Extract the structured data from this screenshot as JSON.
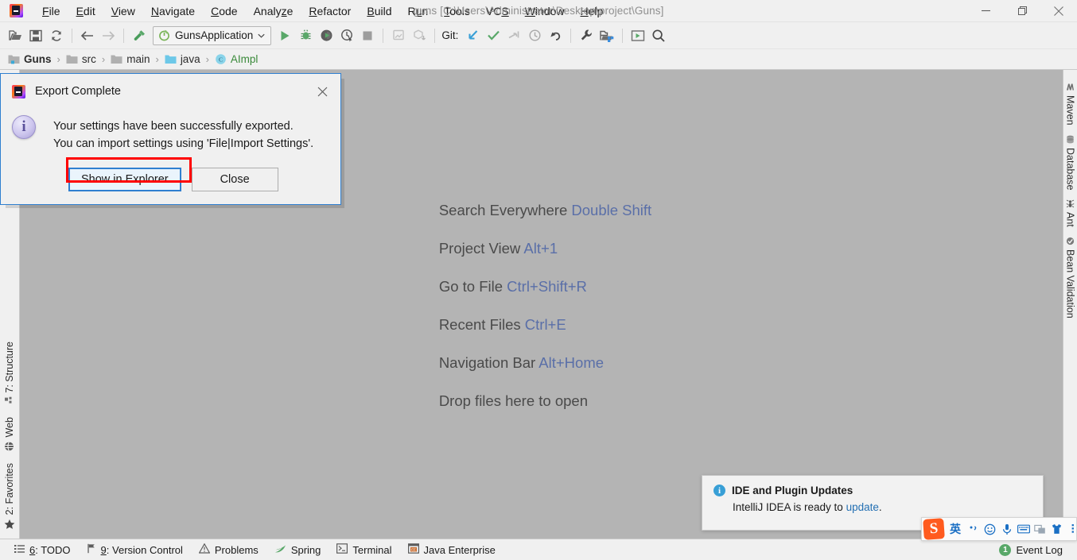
{
  "window": {
    "title": "guns [C:\\Users\\Administrator\\Desktop\\project\\Guns]",
    "minimize_label": "minimize-icon",
    "maximize_label": "restore-icon",
    "close_label": "close-icon"
  },
  "menubar": {
    "items": [
      {
        "label": "File",
        "mnemonic": "F"
      },
      {
        "label": "Edit",
        "mnemonic": "E"
      },
      {
        "label": "View",
        "mnemonic": "V"
      },
      {
        "label": "Navigate",
        "mnemonic": "N"
      },
      {
        "label": "Code",
        "mnemonic": "C"
      },
      {
        "label": "Analyze",
        "mnemonic": "z"
      },
      {
        "label": "Refactor",
        "mnemonic": "R"
      },
      {
        "label": "Build",
        "mnemonic": "B"
      },
      {
        "label": "Run",
        "mnemonic": "u"
      },
      {
        "label": "Tools",
        "mnemonic": "T"
      },
      {
        "label": "VCS",
        "mnemonic": "S"
      },
      {
        "label": "Window",
        "mnemonic": "W"
      },
      {
        "label": "Help",
        "mnemonic": "H"
      }
    ]
  },
  "toolbar": {
    "open_icon": "open-folder-icon",
    "save_icon": "save-icon",
    "sync_icon": "sync-icon",
    "back_icon": "back-arrow-icon",
    "forward_icon": "forward-arrow-icon",
    "build_icon": "build-hammer-icon",
    "run_config": "GunsApplication",
    "run_icon": "run-icon",
    "debug_icon": "debug-icon",
    "run_coverage_icon": "run-with-coverage-icon",
    "profile_icon": "profiler-icon",
    "stop_icon": "stop-icon",
    "update_app_icon": "update-application-icon",
    "deploy_icon": "deploy-icon",
    "git_label": "Git:",
    "git_update_icon": "git-update-project-icon",
    "git_commit_icon": "git-commit-icon",
    "git_push_icon": "git-push-icon",
    "git_history_icon": "git-history-icon",
    "git_rollback_icon": "git-rollback-icon",
    "settings_icon": "wrench-settings-icon",
    "project_structure_icon": "project-structure-icon",
    "run_console_icon": "run-console-icon",
    "search_icon": "search-icon"
  },
  "breadcrumb": {
    "items": [
      {
        "label": "Guns",
        "icon": "project-folder-icon",
        "bold": true,
        "color": "#2b2b2b"
      },
      {
        "label": "src",
        "icon": "folder-icon",
        "bold": false,
        "color": "#2b2b2b"
      },
      {
        "label": "main",
        "icon": "folder-icon",
        "bold": false,
        "color": "#2b2b2b"
      },
      {
        "label": "java",
        "icon": "source-folder-icon",
        "bold": false,
        "color": "#2b2b2b"
      },
      {
        "label": "AImpl",
        "icon": "java-class-icon",
        "bold": false,
        "color": "#3a8a3a"
      }
    ],
    "separator": "›"
  },
  "sidebar_left": {
    "items": [
      {
        "label": "7: Structure",
        "mnemonic": "7",
        "icon": "structure-icon"
      },
      {
        "label": "Web",
        "mnemonic": "",
        "icon": "web-globe-icon"
      },
      {
        "label": "2: Favorites",
        "mnemonic": "2",
        "icon": "favorites-star-icon"
      }
    ]
  },
  "sidebar_right": {
    "items": [
      {
        "label": "Maven",
        "icon": "maven-icon"
      },
      {
        "label": "Database",
        "icon": "database-icon"
      },
      {
        "label": "Ant",
        "icon": "ant-icon"
      },
      {
        "label": "Bean Validation",
        "icon": "bean-validation-icon"
      }
    ]
  },
  "editor": {
    "hints": [
      {
        "action": "Search Everywhere",
        "shortcut": "Double Shift"
      },
      {
        "action": "Project View",
        "shortcut": "Alt+1"
      },
      {
        "action": "Go to File",
        "shortcut": "Ctrl+Shift+R"
      },
      {
        "action": "Recent Files",
        "shortcut": "Ctrl+E"
      },
      {
        "action": "Navigation Bar",
        "shortcut": "Alt+Home"
      },
      {
        "action": "Drop files here to open",
        "shortcut": ""
      }
    ],
    "background_color": "#b4b4b4",
    "shortcut_color": "#5a6fa8"
  },
  "dialog": {
    "title": "Export Complete",
    "icon": "intellij-idea-icon",
    "close_icon": "close-icon",
    "info_icon": "info-icon",
    "message_line1": "Your settings have been successfully exported.",
    "message_line2": "You can import settings using 'File|Import Settings'.",
    "primary_button": "Show in Explorer",
    "secondary_button": "Close",
    "highlight_color": "#ff0000",
    "focus_border_color": "#2f7fd0"
  },
  "notification": {
    "icon": "info-icon",
    "title": "IDE and Plugin Updates",
    "body_prefix": "IntelliJ IDEA is ready to ",
    "link": "update",
    "body_suffix": ".",
    "link_color": "#2470b3"
  },
  "statusbar": {
    "items": [
      {
        "label": "6: TODO",
        "mnemonic": "6",
        "icon": "todo-list-icon"
      },
      {
        "label": "9: Version Control",
        "mnemonic": "9",
        "icon": "version-control-icon"
      },
      {
        "label": "Problems",
        "mnemonic": "",
        "icon": "warning-triangle-icon"
      },
      {
        "label": "Spring",
        "mnemonic": "",
        "icon": "spring-leaf-icon"
      },
      {
        "label": "Terminal",
        "mnemonic": "",
        "icon": "terminal-icon"
      },
      {
        "label": "Java Enterprise",
        "mnemonic": "",
        "icon": "java-enterprise-icon"
      }
    ],
    "event_log": {
      "label": "Event Log",
      "count": "1",
      "badge_color": "#59a869"
    }
  },
  "ime": {
    "logo": "S",
    "logo_name": "sogou-logo-icon",
    "mode_label": "英",
    "buttons": [
      {
        "name": "punctuation-toggle-icon",
        "glyph": "’,"
      },
      {
        "name": "emoji-icon",
        "glyph": "☺"
      },
      {
        "name": "voice-input-icon",
        "glyph": "Ἲ4"
      },
      {
        "name": "soft-keyboard-icon",
        "glyph": "⌨"
      },
      {
        "name": "screenshot-icon",
        "glyph": "❐"
      },
      {
        "name": "skin-icon",
        "glyph": "☂"
      },
      {
        "name": "more-menu-icon",
        "glyph": "⋮"
      }
    ]
  }
}
